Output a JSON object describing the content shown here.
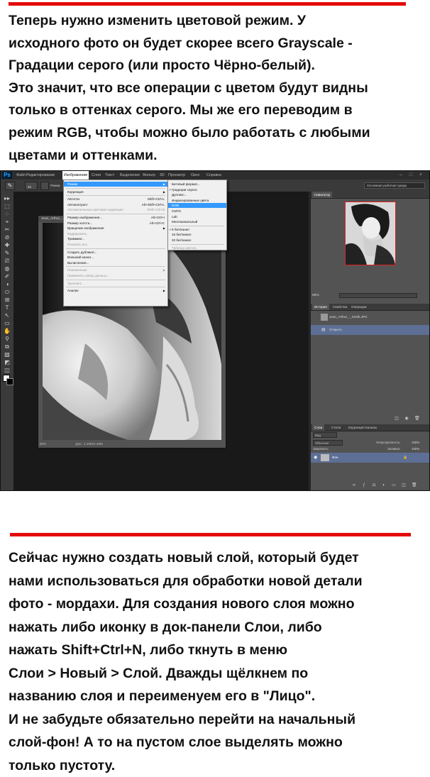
{
  "top_text": {
    "lines": [
      "Теперь нужно изменить цветовой режим. У",
      "исходного фото он будет скорее всего Grayscale -",
      "Градации серого (или просто Чёрно-белый).",
      "Это значит, что все операции с цветом будут видны",
      "только в оттенках серого. Мы же его переводим в",
      "режим RGB, чтобы можно было работать с любыми",
      "цветами и оттенками."
    ]
  },
  "bottom_text": {
    "lines": [
      "Сейчас нужно создать новый слой, который будет",
      "нами использоваться для обработки новой детали",
      "фото - мордахи. Для создания нового слоя можно",
      "нажать либо иконку в док-панели Слои, либо",
      "нажать Shift+Ctrl+N, либо ткнуть в меню",
      "Слои > Новый > Слой. Дважды щёлкнем по",
      "названию слоя и переименуем его в \"Лицо\".",
      "И не забудьте обязательно перейти на начальный",
      "слой-фон! А то на пустом слое выделять можно",
      "только пустоту."
    ]
  },
  "colors": {
    "accent_bar": "#e30b0b",
    "selection": "#3399ff",
    "layer_selected": "#5d6f95"
  },
  "ps": {
    "logo": "Ps",
    "menu": [
      "Файл",
      "Редактирование",
      "Изображение",
      "Слои",
      "Текст",
      "Выделение",
      "Фильтр",
      "3D",
      "Просмотр",
      "Окно",
      "Справка"
    ],
    "active_menu": "Изображение",
    "window_buttons": [
      "–",
      "□",
      "×"
    ],
    "options": {
      "brush_size": "25",
      "mode_label": "Режим"
    },
    "workspace": "Основная рабочая среда",
    "doc_tab": "Jean_Arthur_-_Smith.JPG",
    "doc_status": {
      "zoom": "50%",
      "doc": "Док.: 1,49М/1,49М"
    },
    "image_menu": [
      {
        "label": "Режим",
        "arrow": true,
        "highlight": true
      },
      {
        "sep": true
      },
      {
        "label": "Коррекция",
        "arrow": true
      },
      {
        "sep": true
      },
      {
        "label": "Автотон",
        "shortcut": "Shift+Ctrl+L"
      },
      {
        "label": "Автоконтраст",
        "shortcut": "Alt+Shift+Ctrl+L"
      },
      {
        "label": "Автоматическая цветовая коррекция",
        "shortcut": "Shift+Ctrl+B",
        "dim": true
      },
      {
        "sep": true
      },
      {
        "label": "Размер изображения...",
        "shortcut": "Alt+Ctrl+I"
      },
      {
        "label": "Размер холста...",
        "shortcut": "Alt+Ctrl+C"
      },
      {
        "label": "Вращение изображения",
        "arrow": true
      },
      {
        "label": "Кадрировать",
        "dim": true
      },
      {
        "label": "Тримминг..."
      },
      {
        "label": "Показать все",
        "dim": true
      },
      {
        "sep": true
      },
      {
        "label": "Создать дубликат..."
      },
      {
        "label": "Внешний канал..."
      },
      {
        "label": "Вычисления..."
      },
      {
        "sep": true
      },
      {
        "label": "Переменные",
        "arrow": true,
        "dim": true
      },
      {
        "label": "Применить набор данных...",
        "dim": true
      },
      {
        "sep": true
      },
      {
        "label": "Треппинг...",
        "dim": true
      },
      {
        "sep": true
      },
      {
        "label": "Анализ",
        "arrow": true
      }
    ],
    "mode_submenu": [
      {
        "label": "Битовый формат..."
      },
      {
        "label": "Градации серого",
        "check": true
      },
      {
        "label": "Дуплекс..."
      },
      {
        "label": "Индексированные цвета"
      },
      {
        "label": "RGB",
        "highlight": true
      },
      {
        "label": "CMYK"
      },
      {
        "label": "Lab"
      },
      {
        "label": "Многоканальный"
      },
      {
        "sep": true
      },
      {
        "label": "8 бит/канал",
        "check": true
      },
      {
        "label": "16 бит/канал"
      },
      {
        "label": "32 бит/канал"
      },
      {
        "sep": true
      },
      {
        "label": "Таблица цветов...",
        "dim": true
      }
    ],
    "navigator": {
      "tab": "Навигатор",
      "zoom": "50%"
    },
    "history": {
      "tabs": [
        "История",
        "Свойства",
        "Операции"
      ],
      "snapshot": "Jean_Arthur_-_Smith.JPG",
      "step": "Открыть"
    },
    "layers": {
      "tabs": [
        "Слои",
        "Стили",
        "Коррекция",
        "Каналы"
      ],
      "kind": "Вид",
      "blend": "Обычные",
      "opacity_label": "Непрозрачность:",
      "opacity": "100%",
      "lock_label": "Закрепить:",
      "fill_label": "Заливка:",
      "fill": "100%",
      "layer_name": "Фон"
    }
  }
}
